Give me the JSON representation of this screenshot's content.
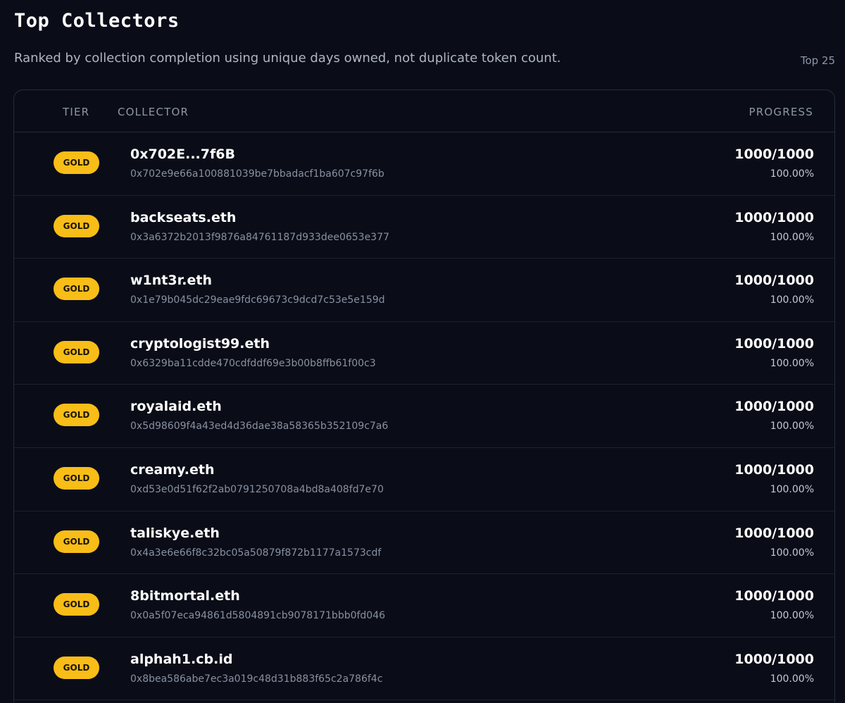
{
  "title": "Top Collectors",
  "subtitle": "Ranked by collection completion using unique days owned, not duplicate token count.",
  "count_label": "Top 25",
  "columns": {
    "tier": "TIER",
    "collector": "COLLECTOR",
    "progress": "PROGRESS"
  },
  "colors": {
    "background": "#0a0d17",
    "gold_badge": "#f9bd18",
    "border": "#262c3a"
  },
  "rows": [
    {
      "tier": "GOLD",
      "name": "0x702E...7f6B",
      "address": "0x702e9e66a100881039be7bbadacf1ba607c97f6b",
      "progress": "1000/1000",
      "percent": "100.00%"
    },
    {
      "tier": "GOLD",
      "name": "backseats.eth",
      "address": "0x3a6372b2013f9876a84761187d933dee0653e377",
      "progress": "1000/1000",
      "percent": "100.00%"
    },
    {
      "tier": "GOLD",
      "name": "w1nt3r.eth",
      "address": "0x1e79b045dc29eae9fdc69673c9dcd7c53e5e159d",
      "progress": "1000/1000",
      "percent": "100.00%"
    },
    {
      "tier": "GOLD",
      "name": "cryptologist99.eth",
      "address": "0x6329ba11cdde470cdfddf69e3b00b8ffb61f00c3",
      "progress": "1000/1000",
      "percent": "100.00%"
    },
    {
      "tier": "GOLD",
      "name": "royalaid.eth",
      "address": "0x5d98609f4a43ed4d36dae38a58365b352109c7a6",
      "progress": "1000/1000",
      "percent": "100.00%"
    },
    {
      "tier": "GOLD",
      "name": "creamy.eth",
      "address": "0xd53e0d51f62f2ab0791250708a4bd8a408fd7e70",
      "progress": "1000/1000",
      "percent": "100.00%"
    },
    {
      "tier": "GOLD",
      "name": "taliskye.eth",
      "address": "0x4a3e6e66f8c32bc05a50879f872b1177a1573cdf",
      "progress": "1000/1000",
      "percent": "100.00%"
    },
    {
      "tier": "GOLD",
      "name": "8bitmortal.eth",
      "address": "0x0a5f07eca94861d5804891cb9078171bbb0fd046",
      "progress": "1000/1000",
      "percent": "100.00%"
    },
    {
      "tier": "GOLD",
      "name": "alphah1.cb.id",
      "address": "0x8bea586abe7ec3a019c48d31b883f65c2a786f4c",
      "progress": "1000/1000",
      "percent": "100.00%"
    }
  ]
}
